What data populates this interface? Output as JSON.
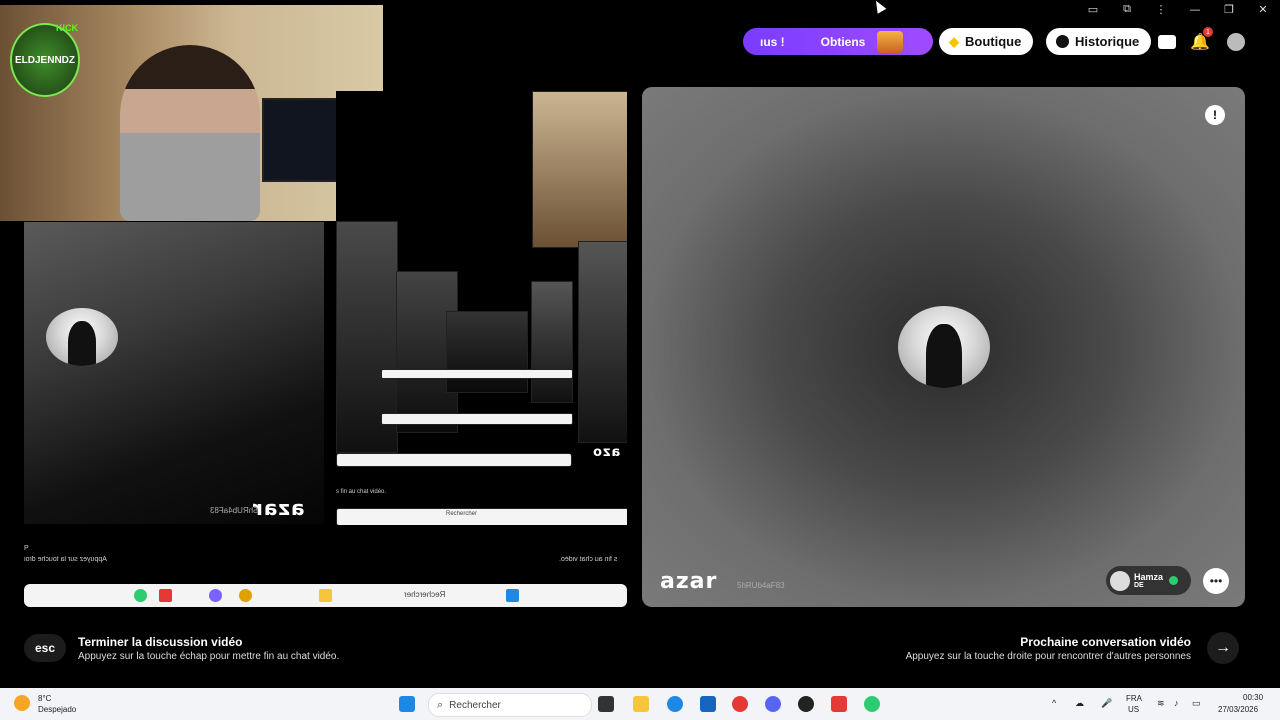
{
  "header": {
    "promo_left": "ıus !",
    "promo_label": "Obtiens",
    "boutique_label": "Boutique",
    "historique_label": "Historique",
    "notification_count": "1"
  },
  "window_controls": [
    "camera-icon",
    "extension-icon",
    "more-icon",
    "minimize-icon",
    "restore-icon",
    "close-icon"
  ],
  "streamer": {
    "logo_text": "ELDJENNDZ",
    "logo_tag": "KICK"
  },
  "left_panel": {
    "mirrored_brand": "azar",
    "mirrored_id": "5hRUb4aF83",
    "mirrored_hint_1": "Appuyez sur la touche droi",
    "mirrored_hint_p": "P",
    "mirrored_text_right": "s fin au chat vidéo.",
    "mirrored_search": "Rechercher"
  },
  "tunnel": {
    "brand": "azo",
    "text1": "s fin au chat vidéo.",
    "search": "Rechercher"
  },
  "right_panel": {
    "brand": "azar",
    "user_id": "5hRUb4aF83",
    "peer_name": "Hamza",
    "peer_country": "DE",
    "report_icon": "!",
    "chat_icon": "chat-icon"
  },
  "bottom": {
    "esc_key": "esc",
    "end_title": "Terminer la discussion vidéo",
    "end_sub": "Appuyez sur la touche échap pour mettre fin au chat vidéo.",
    "next_title": "Prochaine conversation vidéo",
    "next_sub": "Appuyez sur la touche droite pour rencontrer d'autres personnes"
  },
  "taskbar": {
    "weather_temp": "8°C",
    "weather_desc": "Despejado",
    "search_placeholder": "Rechercher",
    "lang_1": "FRA",
    "lang_2": "US",
    "time": "00:30",
    "date": "27/03/2026"
  },
  "colors": {
    "promo": "#8a3cff",
    "bg": "#000000",
    "taskbar": "#f2f4f7"
  }
}
